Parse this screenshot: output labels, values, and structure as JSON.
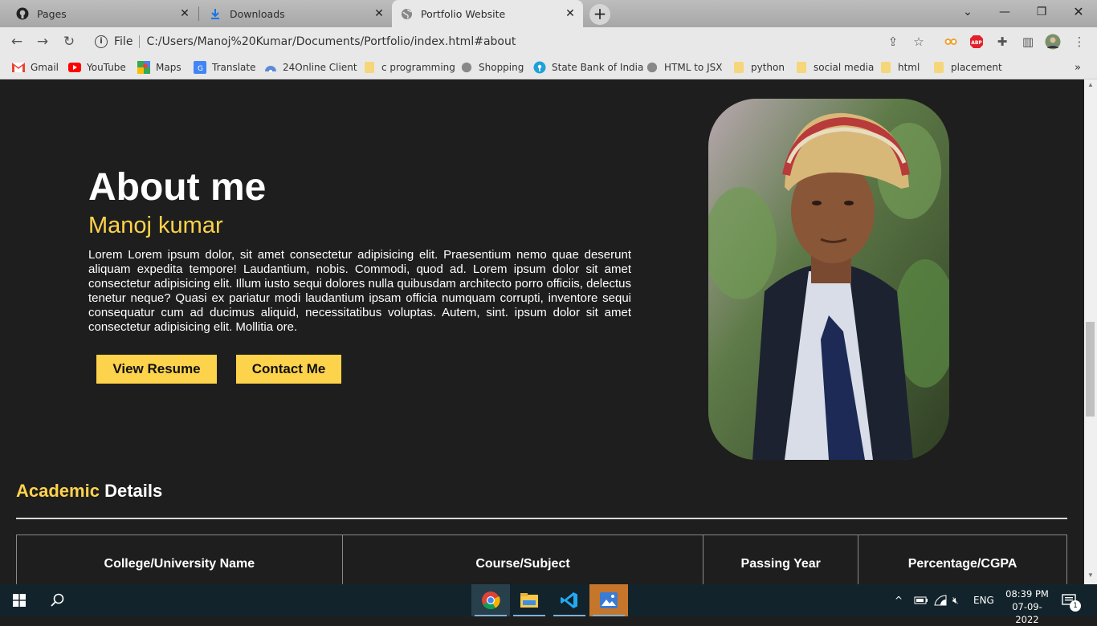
{
  "browser": {
    "tabs": [
      {
        "title": "Pages",
        "icon": "github-icon"
      },
      {
        "title": "Downloads",
        "icon": "download-icon"
      },
      {
        "title": "Portfolio Website",
        "icon": "globe-icon"
      }
    ],
    "address": {
      "scheme_label": "File",
      "url": "C:/Users/Manoj%20Kumar/Documents/Portfolio/index.html#about"
    },
    "bookmarks": [
      {
        "label": "Gmail",
        "icon": "gmail-icon"
      },
      {
        "label": "YouTube",
        "icon": "youtube-icon"
      },
      {
        "label": "Maps",
        "icon": "maps-icon"
      },
      {
        "label": "Translate",
        "icon": "translate-icon"
      },
      {
        "label": "24Online Client",
        "icon": "24online-icon"
      },
      {
        "label": "c programming",
        "icon": "folder-icon"
      },
      {
        "label": "Shopping",
        "icon": "globe-icon"
      },
      {
        "label": "State Bank of India",
        "icon": "sbi-icon"
      },
      {
        "label": "HTML to JSX",
        "icon": "globe-icon"
      },
      {
        "label": "python",
        "icon": "folder-icon"
      },
      {
        "label": "social media",
        "icon": "folder-icon"
      },
      {
        "label": "html",
        "icon": "folder-icon"
      },
      {
        "label": "placement",
        "icon": "folder-icon"
      }
    ]
  },
  "about": {
    "title": "About me",
    "name": "Manoj kumar",
    "description": "Lorem Lorem ipsum dolor, sit amet consectetur adipisicing elit. Praesentium nemo quae deserunt aliquam expedita tempore! Laudantium, nobis. Commodi, quod ad. Lorem ipsum dolor sit amet consectetur adipisicing elit. Illum iusto sequi dolores nulla quibusdam architecto porro officiis, delectus tenetur neque? Quasi ex pariatur modi laudantium ipsam officia numquam corrupti, inventore sequi consequatur cum ad ducimus aliquid, necessitatibus voluptas. Autem, sint. ipsum dolor sit amet consectetur adipisicing elit. Mollitia ore.",
    "buttons": {
      "resume": "View Resume",
      "contact": "Contact Me"
    }
  },
  "academic": {
    "title_highlight": "Academic",
    "title_rest": "Details",
    "columns": [
      "College/University Name",
      "Course/Subject",
      "Passing Year",
      "Percentage/CGPA"
    ]
  },
  "taskbar": {
    "apps": [
      "chrome-icon",
      "file-explorer-icon",
      "vscode-icon",
      "photos-icon"
    ],
    "language": "ENG",
    "time": "08:39 PM",
    "date": "07-09-2022",
    "notification_count": "1"
  },
  "colors": {
    "accent": "#fdd34c",
    "page_bg": "#1e1e1e",
    "taskbar_bg": "#13232b"
  }
}
